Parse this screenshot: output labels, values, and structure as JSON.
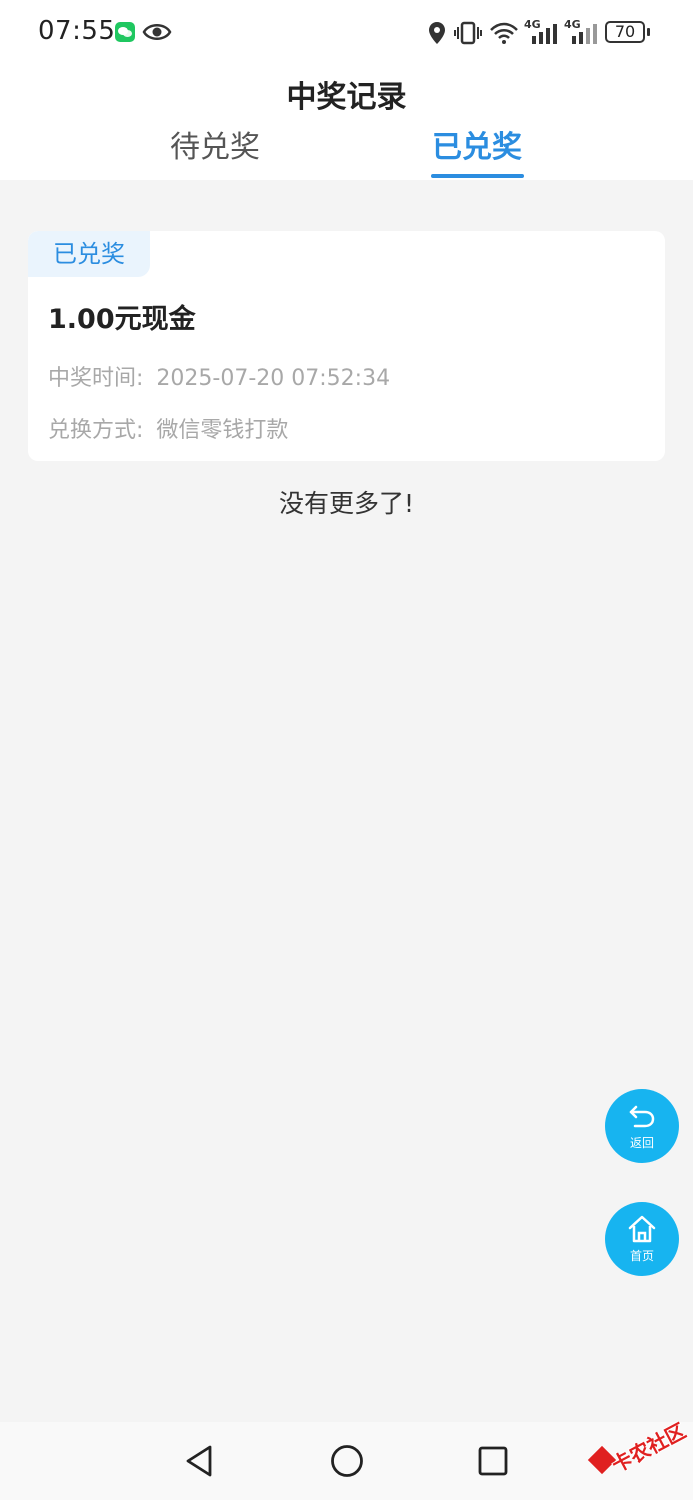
{
  "status_bar": {
    "time": "07:55",
    "battery": "70",
    "network_1": "4G",
    "network_2": "4G"
  },
  "header": {
    "title": "中奖记录",
    "tabs": [
      {
        "label": "待兑奖",
        "active": false
      },
      {
        "label": "已兑奖",
        "active": true
      }
    ]
  },
  "records": [
    {
      "badge": "已兑奖",
      "prize": "1.00元现金",
      "time_label": "中奖时间:",
      "time_value": "2025-07-20 07:52:34",
      "method_label": "兑换方式:",
      "method_value": "微信零钱打款"
    }
  ],
  "list_end_text": "没有更多了!",
  "floating_buttons": {
    "back_label": "返回",
    "home_label": "首页"
  },
  "watermark": {
    "text": "卡农社区"
  },
  "colors": {
    "accent": "#2b8de0",
    "fab": "#17b4f0",
    "background": "#f4f4f4"
  }
}
